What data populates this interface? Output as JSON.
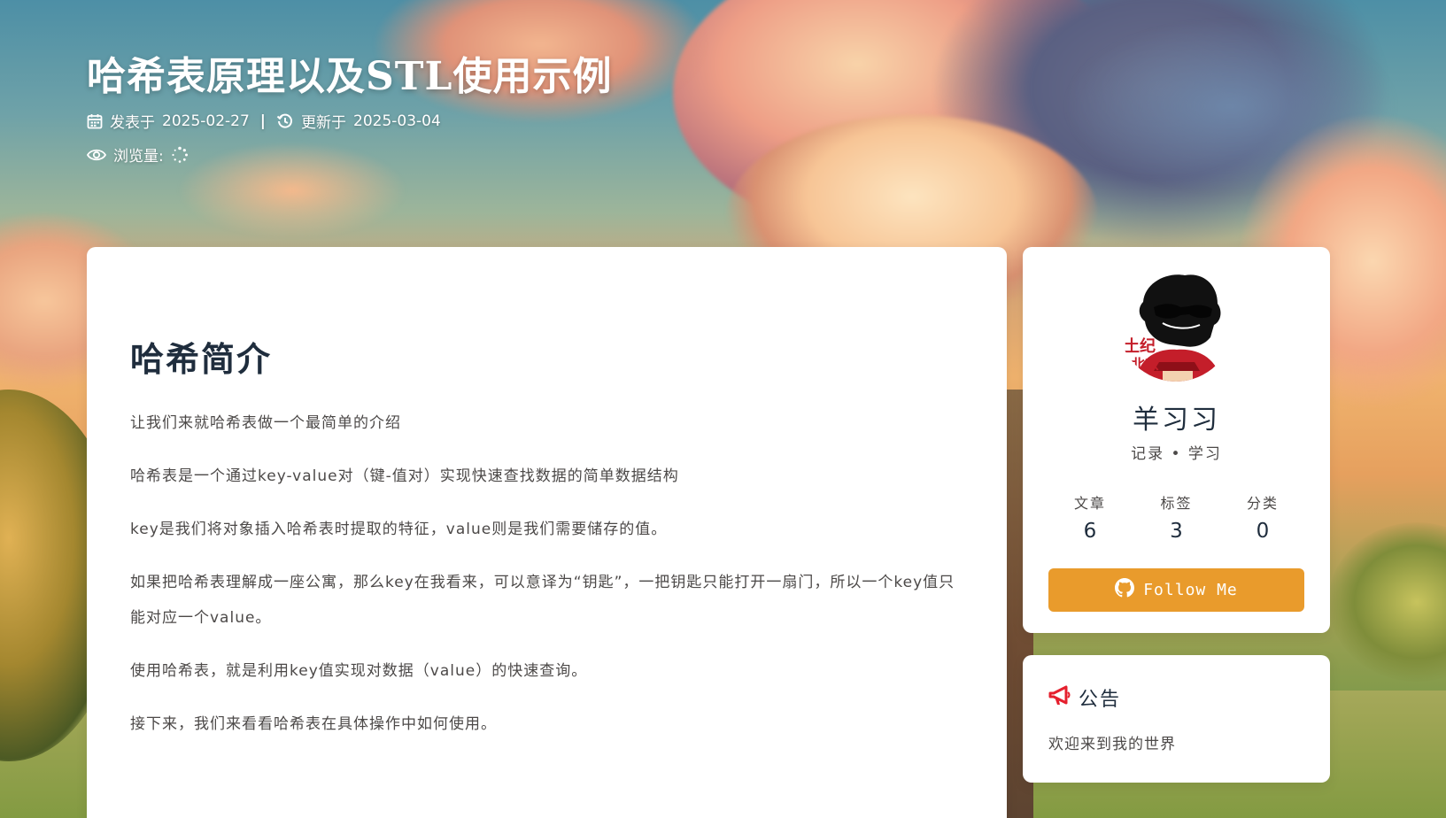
{
  "header": {
    "title": "哈希表原理以及STL使用示例",
    "published_label": "发表于",
    "published_date": "2025-02-27",
    "separator": "|",
    "updated_label": "更新于",
    "updated_date": "2025-03-04",
    "views_label": "浏览量:",
    "icons": {
      "published": "calendar-icon",
      "updated": "history-icon",
      "views": "eye-icon",
      "loading": "loading-spinner-icon"
    }
  },
  "article": {
    "heading": "哈希简介",
    "paragraphs": [
      "让我们来就哈希表做一个最简单的介绍",
      "哈希表是一个通过key-value对（键-值对）实现快速查找数据的简单数据结构",
      "key是我们将对象插入哈希表时提取的特征，value则是我们需要储存的值。",
      "如果把哈希表理解成一座公寓，那么key在我看来，可以意译为“钥匙”，一把钥匙只能打开一扇门，所以一个key值只能对应一个value。",
      "使用哈希表，就是利用key值实现对数据（value）的快速查询。",
      "接下来，我们来看看哈希表在具体操作中如何使用。"
    ]
  },
  "author": {
    "name": "羊习习",
    "description": "记录 • 学习",
    "stats": [
      {
        "label": "文章",
        "value": "6"
      },
      {
        "label": "标签",
        "value": "3"
      },
      {
        "label": "分类",
        "value": "0"
      }
    ],
    "follow_label": "Follow Me",
    "follow_icon": "github-icon"
  },
  "notice": {
    "icon": "bullhorn-icon",
    "title": "公告",
    "text": "欢迎来到我的世界"
  },
  "colors": {
    "accent": "#e99b2c",
    "notice_icon": "#e5202e",
    "heading": "#1f2d3d",
    "text": "#4c4948",
    "card": "#ffffff"
  }
}
